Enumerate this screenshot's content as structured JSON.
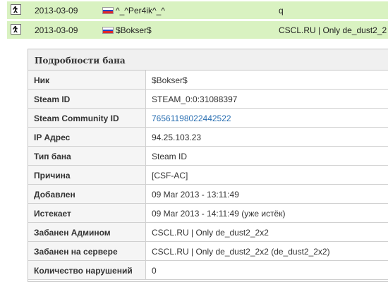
{
  "list": {
    "rows": [
      {
        "date": "2013-03-09",
        "name": "^_^Per4ik^_^",
        "server": "q",
        "flag_icon": "russia-flag",
        "game_icon": "counter-strike-icon"
      },
      {
        "date": "2013-03-09",
        "name": "$Bokser$",
        "server": "CSCL.RU | Only de_dust2_2",
        "flag_icon": "russia-flag",
        "game_icon": "counter-strike-icon"
      }
    ],
    "row_color": "#d9f2c1"
  },
  "details": {
    "title": "Подробности бана",
    "header_color": "#f0f0f0",
    "link_color": "#2a6fb2",
    "rows": [
      {
        "label": "Ник",
        "value": "$Bokser$"
      },
      {
        "label": "Steam ID",
        "value": "STEAM_0:0:31088397"
      },
      {
        "label": "Steam Community ID",
        "value": "76561198022442522"
      },
      {
        "label": "IP Адрес",
        "value": "94.25.103.23"
      },
      {
        "label": "Тип бана",
        "value": "Steam ID"
      },
      {
        "label": "Причина",
        "value": "[CSF-AC]"
      },
      {
        "label": "Добавлен",
        "value": "09 Mar 2013 - 13:11:49"
      },
      {
        "label": "Истекает",
        "value": "09 Mar 2013 - 14:11:49 (уже истёк)"
      },
      {
        "label": "Забанен Админом",
        "value": "CSCL.RU | Only de_dust2_2x2"
      },
      {
        "label": "Забанен на сервере",
        "value": "CSCL.RU | Only de_dust2_2x2 (de_dust2_2x2)"
      },
      {
        "label": "Количество нарушений",
        "value": "0"
      }
    ]
  }
}
